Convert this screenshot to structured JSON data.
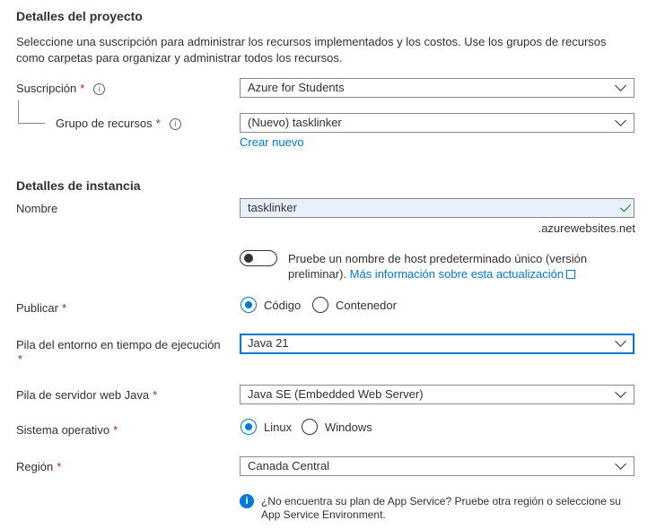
{
  "project": {
    "heading": "Detalles del proyecto",
    "description": "Seleccione una suscripción para administrar los recursos implementados y los costos. Use los grupos de recursos como carpetas para organizar y administrar todos los recursos.",
    "subscription_label": "Suscripción",
    "subscription_value": "Azure for Students",
    "resource_group_label": "Grupo de recursos",
    "resource_group_value": "(Nuevo) tasklinker",
    "create_new": "Crear nuevo"
  },
  "instance": {
    "heading": "Detalles de instancia",
    "name_label": "Nombre",
    "name_value": "tasklinker",
    "domain_suffix": ".azurewebsites.net",
    "toggle_on": false,
    "toggle_text": "Pruebe un nombre de host predeterminado único (versión preliminar).",
    "toggle_link": "Más información sobre esta actualización",
    "publish_label": "Publicar",
    "publish_options": [
      "Código",
      "Contenedor"
    ],
    "publish_selected": "Código",
    "runtime_label": "Pila del entorno en tiempo de ejecución",
    "runtime_value": "Java 21",
    "webserver_label": "Pila de servidor web Java",
    "webserver_value": "Java SE (Embedded Web Server)",
    "os_label": "Sistema operativo",
    "os_options": [
      "Linux",
      "Windows"
    ],
    "os_selected": "Linux",
    "region_label": "Región",
    "region_value": "Canada Central",
    "region_note": "¿No encuentra su plan de App Service? Pruebe otra región o seleccione su App Service Environment."
  },
  "ui": {
    "required_mark": "*",
    "info_glyph": "i"
  },
  "colors": {
    "accent": "#0078d4",
    "required": "#a4262c",
    "success": "#107c10",
    "autofill_bg": "#e8f0fe"
  },
  "icons": [
    "info-icon",
    "chevron-down-icon",
    "checkmark-icon",
    "external-link-icon",
    "info-filled-icon"
  ]
}
